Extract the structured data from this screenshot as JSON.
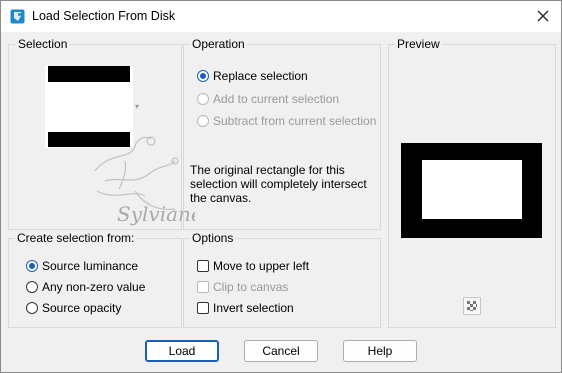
{
  "window": {
    "title": "Load Selection From Disk"
  },
  "selection": {
    "label": "Selection"
  },
  "operation": {
    "label": "Operation",
    "options": [
      {
        "label": "Replace selection",
        "selected": true,
        "enabled": true
      },
      {
        "label": "Add to current selection",
        "selected": false,
        "enabled": false
      },
      {
        "label": "Subtract from current selection",
        "selected": false,
        "enabled": false
      }
    ],
    "description": "The original rectangle for this selection will completely intersect the canvas."
  },
  "preview": {
    "label": "Preview"
  },
  "create_from": {
    "label": "Create selection from:",
    "options": [
      {
        "label": "Source luminance",
        "selected": true
      },
      {
        "label": "Any non-zero value",
        "selected": false
      },
      {
        "label": "Source opacity",
        "selected": false
      }
    ]
  },
  "options": {
    "label": "Options",
    "items": [
      {
        "label": "Move to upper left",
        "checked": false,
        "enabled": true
      },
      {
        "label": "Clip to canvas",
        "checked": false,
        "enabled": false
      },
      {
        "label": "Invert selection",
        "checked": false,
        "enabled": true
      }
    ]
  },
  "buttons": {
    "load": "Load",
    "cancel": "Cancel",
    "help": "Help"
  },
  "watermark": {
    "text": "Sylviane"
  },
  "colors": {
    "accent": "#1a5fb4",
    "border": "#d9d9d9"
  }
}
